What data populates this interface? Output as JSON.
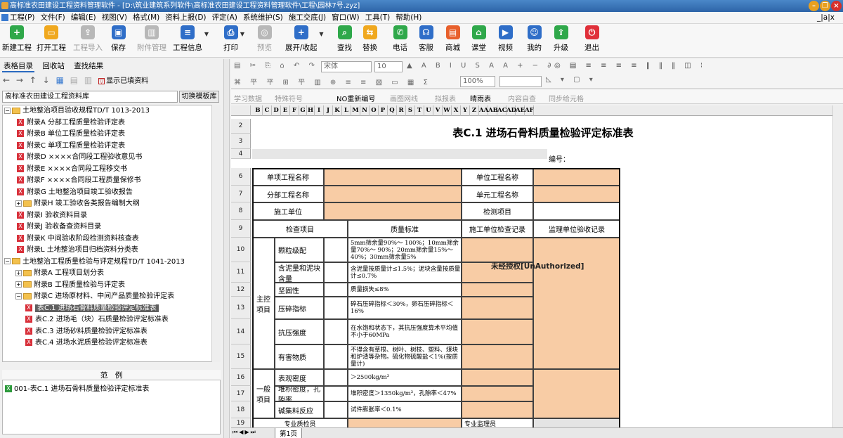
{
  "window": {
    "title": "高标准农田建设工程资料管理软件 - [D:\\筑业建筑系列软件\\高标准农田建设工程资料管理软件\\工程\\园林7号.zyz]"
  },
  "menu": [
    "工程(P)",
    "文件(F)",
    "编辑(E)",
    "视图(V)",
    "格式(M)",
    "资料上报(D)",
    "评定(A)",
    "系统维护(S)",
    "施工交底(J)",
    "窗口(W)",
    "工具(T)",
    "帮助(H)"
  ],
  "mdi_controls": "_|a|x",
  "toolbar": [
    {
      "label": "新建工程",
      "icon": "new-project-icon",
      "color": "#2fa84a",
      "glyph": "+"
    },
    {
      "label": "打开工程",
      "icon": "open-project-icon",
      "color": "#f0a81e",
      "glyph": "▭"
    },
    {
      "label": "工程导入",
      "icon": "import-icon",
      "color": "#b8b8b8",
      "glyph": "⇪",
      "disabled": true
    },
    {
      "label": "保存",
      "icon": "save-icon",
      "color": "#2f6ec8",
      "glyph": "▣"
    },
    {
      "label": "附件管理",
      "icon": "attachment-icon",
      "color": "#b8b8b8",
      "glyph": "▥",
      "disabled": true
    },
    {
      "label": "工程信息",
      "icon": "project-info-icon",
      "color": "#2f6ec8",
      "glyph": "≡"
    },
    {
      "label": "打印",
      "icon": "print-icon",
      "color": "#2f6ec8",
      "glyph": "⎙"
    },
    {
      "label": "预览",
      "icon": "preview-icon",
      "color": "#b8b8b8",
      "glyph": "◎",
      "disabled": true
    },
    {
      "label": "展开/收起",
      "icon": "expand-collapse-icon",
      "color": "#2f6ec8",
      "glyph": "+"
    },
    {
      "label": "查找",
      "icon": "find-icon",
      "color": "#2fa84a",
      "glyph": "⌕"
    },
    {
      "label": "替换",
      "icon": "replace-icon",
      "color": "#f0a81e",
      "glyph": "⇆"
    },
    {
      "label": "电话",
      "icon": "phone-icon",
      "color": "#2fa84a",
      "glyph": "✆"
    },
    {
      "label": "客服",
      "icon": "service-icon",
      "color": "#2f6ec8",
      "glyph": "☊"
    },
    {
      "label": "商城",
      "icon": "mall-icon",
      "color": "#e8602c",
      "glyph": "▤"
    },
    {
      "label": "课堂",
      "icon": "classroom-icon",
      "color": "#2fa84a",
      "glyph": "⌂"
    },
    {
      "label": "视频",
      "icon": "video-icon",
      "color": "#2f6ec8",
      "glyph": "▶"
    },
    {
      "label": "我的",
      "icon": "user-icon",
      "color": "#2f6ec8",
      "glyph": "☺"
    },
    {
      "label": "升级",
      "icon": "upgrade-icon",
      "color": "#2fa84a",
      "glyph": "⇧"
    },
    {
      "label": "退出",
      "icon": "exit-icon",
      "color": "#e0303a",
      "glyph": "⏻"
    }
  ],
  "left": {
    "tabs": [
      "表格目录",
      "回收站",
      "查找结果"
    ],
    "show_filled": "显示已填资料",
    "library": "高标准农田建设工程资料库",
    "switch_template": "切换模板库",
    "tree": [
      {
        "t": "土地整治项目验收规程TD/T 1013-2013",
        "lv": 0,
        "k": "folder"
      },
      {
        "t": "附录A 分部工程质量检验评定表",
        "lv": 1,
        "k": "doc"
      },
      {
        "t": "附录B 单位工程质量检验评定表",
        "lv": 1,
        "k": "doc"
      },
      {
        "t": "附录C 单项工程质量检验评定表",
        "lv": 1,
        "k": "doc"
      },
      {
        "t": "附录D ××××合同段工程验收意见书",
        "lv": 1,
        "k": "doc"
      },
      {
        "t": "附录E ××××合同段工程移交书",
        "lv": 1,
        "k": "doc"
      },
      {
        "t": "附录F ××××合同段工程质量保修书",
        "lv": 1,
        "k": "doc"
      },
      {
        "t": "附录G 土地整治项目竣工验收报告",
        "lv": 1,
        "k": "doc"
      },
      {
        "t": "附录H 竣工验收各类报告编制大纲",
        "lv": 1,
        "k": "folder"
      },
      {
        "t": "附录I 验收资料目录",
        "lv": 1,
        "k": "doc"
      },
      {
        "t": "附录J 验收备查资料目录",
        "lv": 1,
        "k": "doc"
      },
      {
        "t": "附录K 中间验收阶段检测资料核查表",
        "lv": 1,
        "k": "doc"
      },
      {
        "t": "附录L 土地整治项目归档资料分类表",
        "lv": 1,
        "k": "doc"
      },
      {
        "t": "土地整治工程质量检验与评定规程TD/T 1041-2013",
        "lv": 0,
        "k": "folder"
      },
      {
        "t": "附录A 工程项目划分表",
        "lv": 1,
        "k": "folder"
      },
      {
        "t": "附录B 工程质量检验与评定表",
        "lv": 1,
        "k": "folder"
      },
      {
        "t": "附录C 进场原材料、中间产品质量检验评定表",
        "lv": 1,
        "k": "folder"
      },
      {
        "t": "表C.1 进场石骨料质量检验评定标准表",
        "lv": 2,
        "k": "doc",
        "sel": true
      },
      {
        "t": "表C.2 进场毛（块）石质量检验评定标准表",
        "lv": 2,
        "k": "doc"
      },
      {
        "t": "表C.3 进场砂料质量检验评定标准表",
        "lv": 2,
        "k": "doc"
      },
      {
        "t": "表C.4 进场水泥质量检验评定标准表",
        "lv": 2,
        "k": "doc"
      }
    ],
    "example_header": "范　例",
    "example_item": "001-表C.1 进场石骨料质量检验评定标准表"
  },
  "format": {
    "font": "宋体",
    "size": "10",
    "zoom": "100%",
    "row2_items": [
      "学习数据",
      "特殊符号",
      "NO重新编号",
      "画图网线",
      "拟报表",
      "晴雨表",
      "内容自查",
      "同步给元格"
    ]
  },
  "sheet": {
    "columns": [
      "B",
      "C",
      "D",
      "E",
      "F",
      "G",
      "H",
      "I",
      "J",
      "K",
      "L",
      "M",
      "N",
      "O",
      "P",
      "Q",
      "R",
      "S",
      "T",
      "U",
      "V",
      "W",
      "X",
      "Y",
      "Z",
      "AA",
      "AB",
      "AC",
      "AD",
      "AE",
      "AF"
    ],
    "rows": [
      "2",
      "3",
      "4",
      "6",
      "7",
      "8",
      "9",
      "10",
      "11",
      "12",
      "13",
      "14",
      "15",
      "16",
      "17",
      "18",
      "19"
    ],
    "title": "表C.1  进场石骨料质量检验评定标准表",
    "number_label": "编号：",
    "hdr": {
      "proj": "单项工程名称",
      "unit": "单位工程名称",
      "sub": "分部工程名称",
      "elem": "单元工程名称",
      "constr": "施工单位",
      "item": "检测项目"
    },
    "col_hdr": {
      "check": "检查项目",
      "std": "质量标准",
      "rec": "施工单位检查记录",
      "sup": "监理单位验收记录"
    },
    "main_label": "主控\n项目",
    "general_label": "一般\n项目",
    "main_items": [
      {
        "name": "颗粒级配",
        "std": "5mm筛余量90%～ 100%；10mm筛余量70%～ 90%；20mm筛余量15%～ 40%；30mm筛余量5%"
      },
      {
        "name": "含泥量和泥块含量",
        "std": "含泥量按质量计≤1.5%；泥块含量按质量计≤0.7%"
      },
      {
        "name": "坚固性",
        "std": "质量损失≤8%"
      },
      {
        "name": "压碎指标",
        "std": "碎石压碎指标＜30%，卵石压碎指标＜16%"
      },
      {
        "name": "抗压强度",
        "std": "在水饱和状态下，其抗压强度算术平均值不小于60MPa"
      },
      {
        "name": "有害物质",
        "std": "不得含有草根、树叶、树枝、塑料、煤块和炉渣等杂物。硫化物硫酸盐＜1%(按质量计)"
      }
    ],
    "general_items": [
      {
        "name": "表观密度",
        "std": "＞2500kg/m³"
      },
      {
        "name": "堆积密度，孔隙率",
        "std": "堆积密度＞1350kg/m³，孔隙率＜47%"
      },
      {
        "name": "碱集料反应",
        "std": "试件膨胀率＜0.1%"
      }
    ],
    "last_row": {
      "a": "专业质检员",
      "b": "专业监理员"
    },
    "watermark": "未经授权[UnAuthorized]",
    "sheet_tab": "第1页"
  },
  "colors": {
    "pink": "#f8cca5",
    "sel": "#5f5f5f",
    "titlebar": "#2d64a8"
  }
}
